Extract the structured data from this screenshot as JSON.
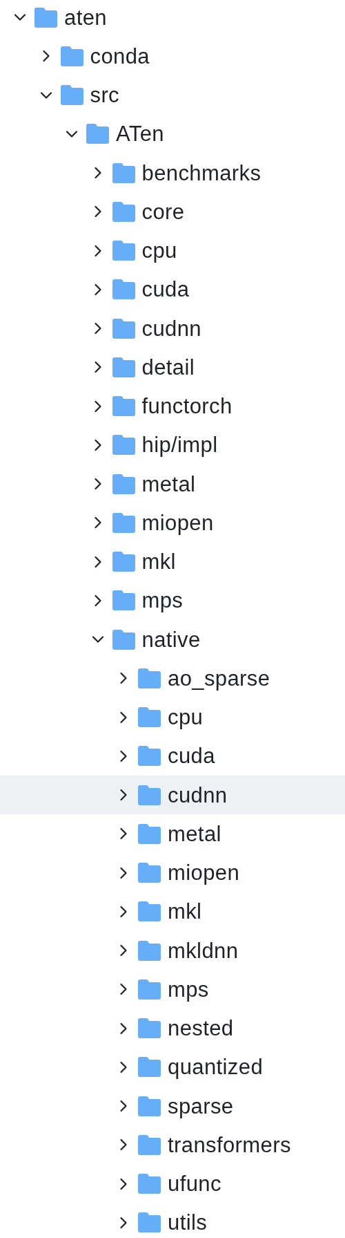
{
  "tree": [
    {
      "name": "aten",
      "expanded": true,
      "selected": false,
      "children": [
        {
          "name": "conda",
          "expanded": false,
          "selected": false
        },
        {
          "name": "src",
          "expanded": true,
          "selected": false,
          "children": [
            {
              "name": "ATen",
              "expanded": true,
              "selected": false,
              "children": [
                {
                  "name": "benchmarks",
                  "expanded": false,
                  "selected": false
                },
                {
                  "name": "core",
                  "expanded": false,
                  "selected": false
                },
                {
                  "name": "cpu",
                  "expanded": false,
                  "selected": false
                },
                {
                  "name": "cuda",
                  "expanded": false,
                  "selected": false
                },
                {
                  "name": "cudnn",
                  "expanded": false,
                  "selected": false
                },
                {
                  "name": "detail",
                  "expanded": false,
                  "selected": false
                },
                {
                  "name": "functorch",
                  "expanded": false,
                  "selected": false
                },
                {
                  "name": "hip/impl",
                  "expanded": false,
                  "selected": false
                },
                {
                  "name": "metal",
                  "expanded": false,
                  "selected": false
                },
                {
                  "name": "miopen",
                  "expanded": false,
                  "selected": false
                },
                {
                  "name": "mkl",
                  "expanded": false,
                  "selected": false
                },
                {
                  "name": "mps",
                  "expanded": false,
                  "selected": false
                },
                {
                  "name": "native",
                  "expanded": true,
                  "selected": false,
                  "children": [
                    {
                      "name": "ao_sparse",
                      "expanded": false,
                      "selected": false
                    },
                    {
                      "name": "cpu",
                      "expanded": false,
                      "selected": false
                    },
                    {
                      "name": "cuda",
                      "expanded": false,
                      "selected": false
                    },
                    {
                      "name": "cudnn",
                      "expanded": false,
                      "selected": true
                    },
                    {
                      "name": "metal",
                      "expanded": false,
                      "selected": false
                    },
                    {
                      "name": "miopen",
                      "expanded": false,
                      "selected": false
                    },
                    {
                      "name": "mkl",
                      "expanded": false,
                      "selected": false
                    },
                    {
                      "name": "mkldnn",
                      "expanded": false,
                      "selected": false
                    },
                    {
                      "name": "mps",
                      "expanded": false,
                      "selected": false
                    },
                    {
                      "name": "nested",
                      "expanded": false,
                      "selected": false
                    },
                    {
                      "name": "quantized",
                      "expanded": false,
                      "selected": false
                    },
                    {
                      "name": "sparse",
                      "expanded": false,
                      "selected": false
                    },
                    {
                      "name": "transformers",
                      "expanded": false,
                      "selected": false
                    },
                    {
                      "name": "ufunc",
                      "expanded": false,
                      "selected": false
                    },
                    {
                      "name": "utils",
                      "expanded": false,
                      "selected": false
                    }
                  ]
                }
              ]
            }
          ]
        }
      ]
    }
  ]
}
